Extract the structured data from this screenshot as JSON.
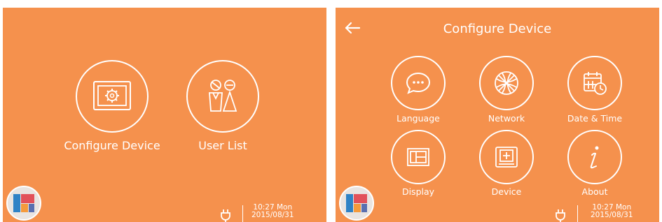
{
  "home": {
    "items": [
      {
        "label": "Configure Device",
        "icon": "configure-device-icon"
      },
      {
        "label": "User List",
        "icon": "user-list-icon"
      }
    ],
    "status": {
      "time": "10:27 Mon",
      "date": "2015/08/31"
    }
  },
  "configure": {
    "title": "Configure Device",
    "items": [
      {
        "label": "Language",
        "icon": "chat-bubble-icon"
      },
      {
        "label": "Network",
        "icon": "globe-icon"
      },
      {
        "label": "Date & Time",
        "icon": "calendar-clock-icon"
      },
      {
        "label": "Display",
        "icon": "display-layout-icon"
      },
      {
        "label": "Device",
        "icon": "device-icon"
      },
      {
        "label": "About",
        "icon": "info-icon"
      }
    ],
    "status": {
      "time": "10:27 Mon",
      "date": "2015/08/31"
    }
  },
  "colors": {
    "background": "#f5914d",
    "foreground": "#ffffff",
    "launcher_bg": "#e9e4e1",
    "tile_blue": "#2f82c6",
    "tile_red": "#e2515a",
    "tile_orange": "#f59a3c"
  }
}
